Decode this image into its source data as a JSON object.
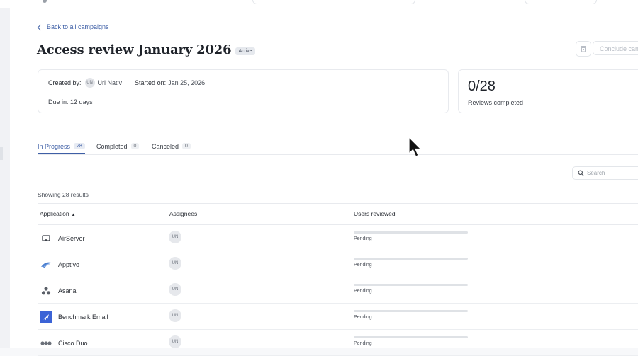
{
  "header": {},
  "back_link": {
    "label": "Back to all campaigns"
  },
  "campaign": {
    "title": "Access review January 2026",
    "status": "Active",
    "delete_icon": "trash-icon",
    "conclude_label": "Conclude camp"
  },
  "info": {
    "created_by_label": "Created by:",
    "creator_initials": "UN",
    "creator_name": "Uri Nativ",
    "started_label": "Started on:",
    "started_value": "Jan 25, 2026",
    "due_label": "Due in:",
    "due_value": "12 days"
  },
  "progress": {
    "value": "0/28",
    "label": "Reviews completed"
  },
  "tabs": [
    {
      "label": "In Progress",
      "count": "28",
      "active": true
    },
    {
      "label": "Completed",
      "count": "0",
      "active": false
    },
    {
      "label": "Canceled",
      "count": "0",
      "active": false
    }
  ],
  "search": {
    "placeholder": "Search",
    "icon": "search-icon"
  },
  "results": {
    "label": "Showing 28 results"
  },
  "table": {
    "columns": [
      "Application",
      "Assignees",
      "Users reviewed"
    ],
    "sort_indicator": "▲",
    "rows": [
      {
        "app": "AirServer",
        "icon": "airserver-icon",
        "assignee": "UN",
        "progress": 0,
        "status": "Pending"
      },
      {
        "app": "Apptivo",
        "icon": "apptivo-icon",
        "assignee": "UN",
        "progress": 0,
        "status": "Pending"
      },
      {
        "app": "Asana",
        "icon": "asana-icon",
        "assignee": "UN",
        "progress": 0,
        "status": "Pending"
      },
      {
        "app": "Benchmark Email",
        "icon": "benchmark-email-icon",
        "assignee": "UN",
        "progress": 0,
        "status": "Pending"
      },
      {
        "app": "Cisco Duo",
        "icon": "cisco-duo-icon",
        "assignee": "UN",
        "progress": 0,
        "status": "Pending"
      }
    ]
  },
  "colors": {
    "accent": "#3e5fa6",
    "benchmark": "#3b63d6"
  }
}
